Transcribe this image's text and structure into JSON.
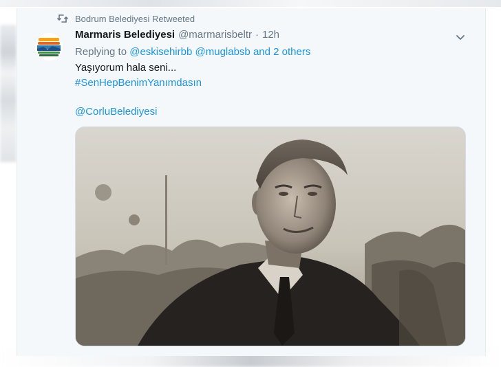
{
  "retweet": {
    "icon": "retweet-icon",
    "text": "Bodrum Belediyesi Retweeted"
  },
  "tweet": {
    "display_name": "Marmaris Belediyesi",
    "handle": "@marmarisbeltr",
    "separator": "·",
    "time": "12h",
    "replying_prefix": "Replying to",
    "replying_user_1": "@eskisehirbb",
    "replying_user_2": "@muglabsb",
    "replying_others": "and 2 others",
    "body_line_1": "Yaşıyorum hala seni...",
    "hashtag": "#SenHepBenimYanımdasın",
    "mention": "@CorluBelediyesi",
    "menu_icon": "chevron-down-icon",
    "photo": "sepia portrait photo"
  },
  "colors": {
    "card_bg": "#f5f8fa",
    "text": "#14171a",
    "muted": "#657786",
    "link": "#1b95e0"
  }
}
